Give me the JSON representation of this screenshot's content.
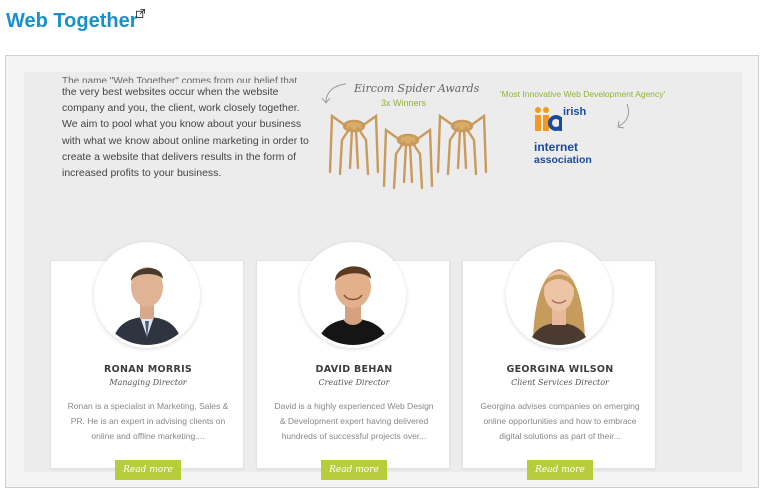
{
  "page": {
    "title": "Web Together"
  },
  "intro": {
    "fade_line": "The name \"Web Together\" comes from our belief that",
    "text": "the very best websites occur when the website company and you, the client, work closely together. We aim to pool what you know about your business with what we know about online marketing in order to create a website that delivers results in the form of increased profits to your business."
  },
  "awards": {
    "title": "Eircom Spider Awards",
    "subtitle": "3x Winners"
  },
  "iia": {
    "caption": "'Most Innovative Web Development Agency'",
    "logo_lines": [
      "irish",
      "internet",
      "association"
    ]
  },
  "team": [
    {
      "name": "RONAN MORRIS",
      "role": "Managing Director",
      "bio": "Ronan is a specialist in Marketing, Sales & PR. He is an expert in advising clients on online and offline marketing....",
      "cta": "Read more"
    },
    {
      "name": "DAVID BEHAN",
      "role": "Creative Director",
      "bio": "David is a highly experienced Web Design & Development expert having delivered hundreds of successful projects over...",
      "cta": "Read more"
    },
    {
      "name": "GEORGINA WILSON",
      "role": "Client Services Director",
      "bio": "Georgina advises companies on emerging online opportunities and how to embrace digital solutions as part of their...",
      "cta": "Read more"
    }
  ],
  "colors": {
    "title_blue": "#1a8fc9",
    "accent_green": "#b7cd3c",
    "award_gold": "#c99a5b",
    "iia_blue": "#1b4a9c",
    "iia_orange": "#f39a1e"
  }
}
